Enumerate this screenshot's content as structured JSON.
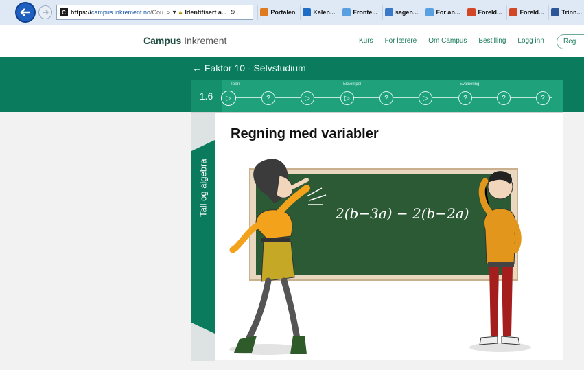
{
  "browser": {
    "url_prefix": "https://",
    "url_host": "campus.inkrement.no",
    "url_rest": "/Cou",
    "cert_label": "Identifisert a...",
    "favorites": [
      {
        "label": "Portalen",
        "icon": "portal-icon",
        "color": "#e07a1e"
      },
      {
        "label": "Kalen...",
        "icon": "outlook-icon",
        "color": "#1f6cc4"
      },
      {
        "label": "Fronte...",
        "icon": "ie-icon",
        "color": "#5aa0e0"
      },
      {
        "label": "sagen...",
        "icon": "site-icon",
        "color": "#3b78c8"
      },
      {
        "label": "For an...",
        "icon": "ie-icon",
        "color": "#5aa0e0"
      },
      {
        "label": "Foreld...",
        "icon": "powerpoint-icon",
        "color": "#d24726"
      },
      {
        "label": "Foreld...",
        "icon": "powerpoint-icon",
        "color": "#d24726"
      },
      {
        "label": "Trinn...",
        "icon": "word-icon",
        "color": "#2b579a"
      }
    ]
  },
  "header": {
    "brand_bold": "Campus",
    "brand_light": " Inkrement",
    "nav": [
      "Kurs",
      "For lærere",
      "Om Campus",
      "Bestilling",
      "Logg inn"
    ],
    "register_label": "Reg"
  },
  "course": {
    "back_title": "← Faktor 10 - Selvstudium",
    "lesson_number": "1.6",
    "step_labels": {
      "teori": "Teori",
      "eksempel": "Eksempel",
      "evaluering": "Evaluering"
    },
    "steps": [
      {
        "type": "play",
        "glyph": "▷",
        "active": true
      },
      {
        "type": "quiz",
        "glyph": "?"
      },
      {
        "type": "play",
        "glyph": "▷"
      },
      {
        "type": "play",
        "glyph": "▷"
      },
      {
        "type": "quiz",
        "glyph": "?"
      },
      {
        "type": "play",
        "glyph": "▷"
      },
      {
        "type": "quiz",
        "glyph": "?"
      },
      {
        "type": "quiz",
        "glyph": "?"
      },
      {
        "type": "quiz",
        "glyph": "?"
      }
    ]
  },
  "content": {
    "side_label": "Tall og algebra",
    "title": "Regning med variabler",
    "board_expression": "2(b−3a) − 2(b−2a)"
  },
  "colors": {
    "brand_green": "#0b7b5e",
    "progress_green": "#1fa27c",
    "chalkboard": "#2b5a35"
  }
}
